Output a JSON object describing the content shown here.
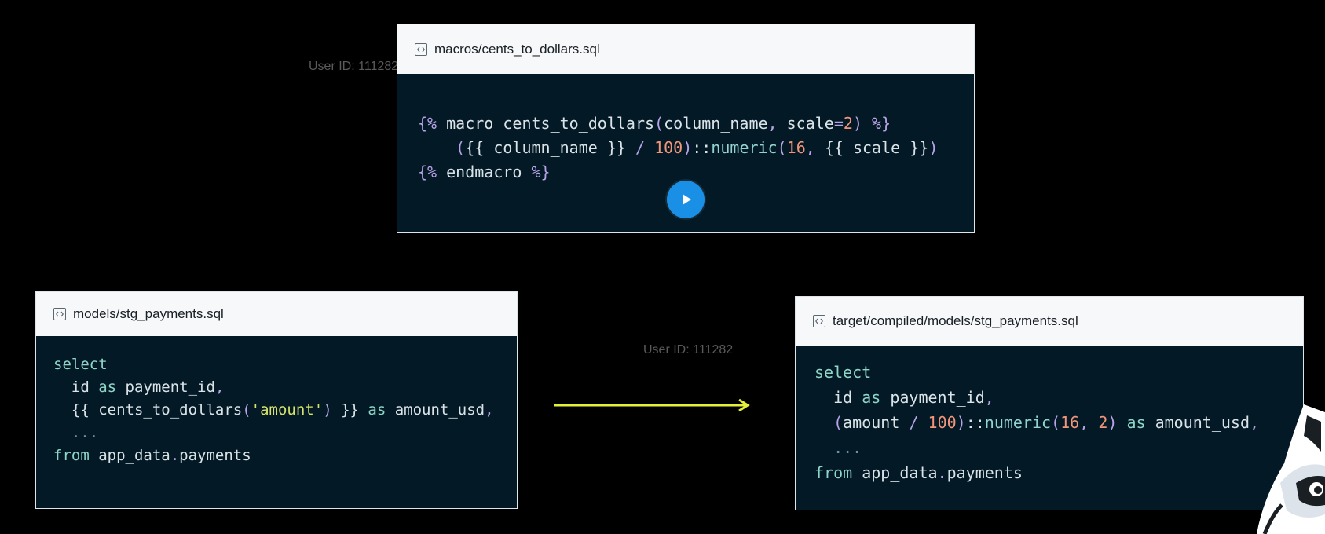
{
  "watermarks": {
    "top": "User ID: 111282",
    "middle": "User ID: 111282"
  },
  "macro_panel": {
    "filename": "macros/cents_to_dollars.sql"
  },
  "model_panel": {
    "filename": "models/stg_payments.sql"
  },
  "compiled_panel": {
    "filename": "target/compiled/models/stg_payments.sql"
  },
  "icons": {
    "file": "code-file-icon",
    "play": "play-icon",
    "arrow": "arrow-right-icon",
    "mascot": "raccoon-mascot"
  },
  "colors": {
    "background": "#000000",
    "code_background": "#031a26",
    "header_background": "#f6f8fa",
    "arrow": "#e2f03a",
    "play_button": "#1a8fe6",
    "keyword": "#8fd5c8",
    "string": "#d7e36a",
    "number": "#f3957a",
    "punctuation": "#b9a3e8"
  }
}
